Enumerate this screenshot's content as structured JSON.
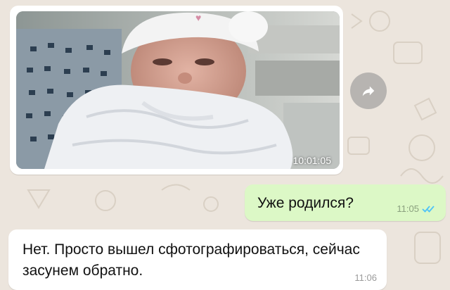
{
  "chat": {
    "messages": [
      {
        "type": "image",
        "direction": "incoming",
        "time_overlay": "10:01:05"
      },
      {
        "type": "text",
        "direction": "outgoing",
        "text": "Уже родился?",
        "time": "11:05",
        "status": "read-double-check"
      },
      {
        "type": "text",
        "direction": "incoming",
        "text": "Нет. Просто вышел сфотографироваться, сейчас засунем обратно.",
        "time": "11:06"
      }
    ]
  },
  "icons": {
    "forward": "forward-arrow-icon",
    "read_receipt": "double-check-icon"
  },
  "colors": {
    "wallpaper": "#ece5dd",
    "outgoing_bubble": "#dcf8c6",
    "incoming_bubble": "#ffffff",
    "read_tick": "#4fc3f7"
  }
}
